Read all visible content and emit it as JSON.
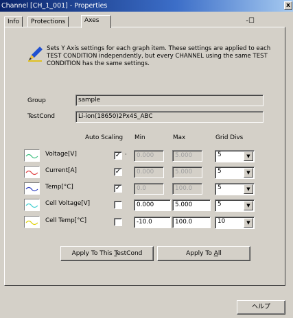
{
  "window": {
    "title": "Channel [CH_1_001] - Properties",
    "close_glyph": "x"
  },
  "tabs": [
    {
      "label": "Info"
    },
    {
      "label": "Protections"
    },
    {
      "label": "Axes"
    }
  ],
  "pin_glyph": "-☐",
  "description": "Sets Y Axis settings for each graph item.  These settings are applied to each TEST CONDITION independently, but every CHANNEL using the same TEST CONDITION has the same settings.",
  "group": {
    "label": "Group",
    "value": "sample"
  },
  "testcond": {
    "label": "TestCond",
    "value": "Li-ion(18650)2Px4S_ABC"
  },
  "headers": {
    "auto": "Auto Scaling",
    "min": "Min",
    "max": "Max",
    "grid": "Grid Divs"
  },
  "rows": [
    {
      "label": "Voltage[V]",
      "auto": "✓",
      "min": "0.000",
      "max": "5.000",
      "grid": "5",
      "color": "#40c080"
    },
    {
      "label": "Current[A]",
      "auto": "✓",
      "min": "0.000",
      "max": "5.000",
      "grid": "5",
      "color": "#e04040"
    },
    {
      "label": "Temp[°C]",
      "auto": "✓",
      "min": "0.0",
      "max": "100.0",
      "grid": "5",
      "color": "#3040c0"
    },
    {
      "label": "Cell Voltage[V]",
      "auto": "",
      "min": "0.000",
      "max": "5.000",
      "grid": "5",
      "color": "#40d0d0"
    },
    {
      "label": "Cell Temp[°C]",
      "auto": "",
      "min": "-10.0",
      "max": "100.0",
      "grid": "10",
      "color": "#e0d000"
    }
  ],
  "buttons": {
    "apply_testcond_pre": "Apply To This ",
    "apply_testcond_u": "T",
    "apply_testcond_post": "estCond",
    "apply_all_pre": "Apply To ",
    "apply_all_u": "A",
    "apply_all_post": "ll",
    "help": "ヘルプ"
  },
  "dropdown_arrow": "▼"
}
